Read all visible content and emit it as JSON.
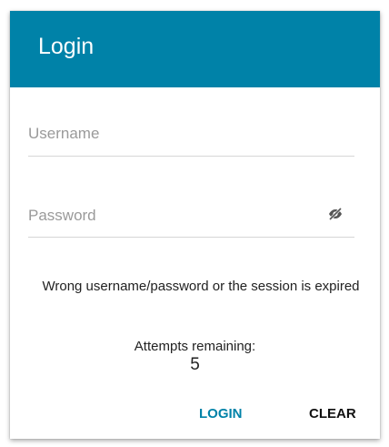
{
  "dialog": {
    "title": "Login"
  },
  "form": {
    "username_placeholder": "Username",
    "username_value": "",
    "password_placeholder": "Password",
    "password_value": ""
  },
  "icons": {
    "password_toggle": "eye-off-icon"
  },
  "messages": {
    "error": "Wrong username/password or the session is expired",
    "attempts_label": "Attempts remaining:",
    "attempts_value": "5"
  },
  "buttons": {
    "login": "LOGIN",
    "clear": "CLEAR"
  },
  "colors": {
    "header_bg": "#0082a8",
    "accent": "#0082a8"
  }
}
